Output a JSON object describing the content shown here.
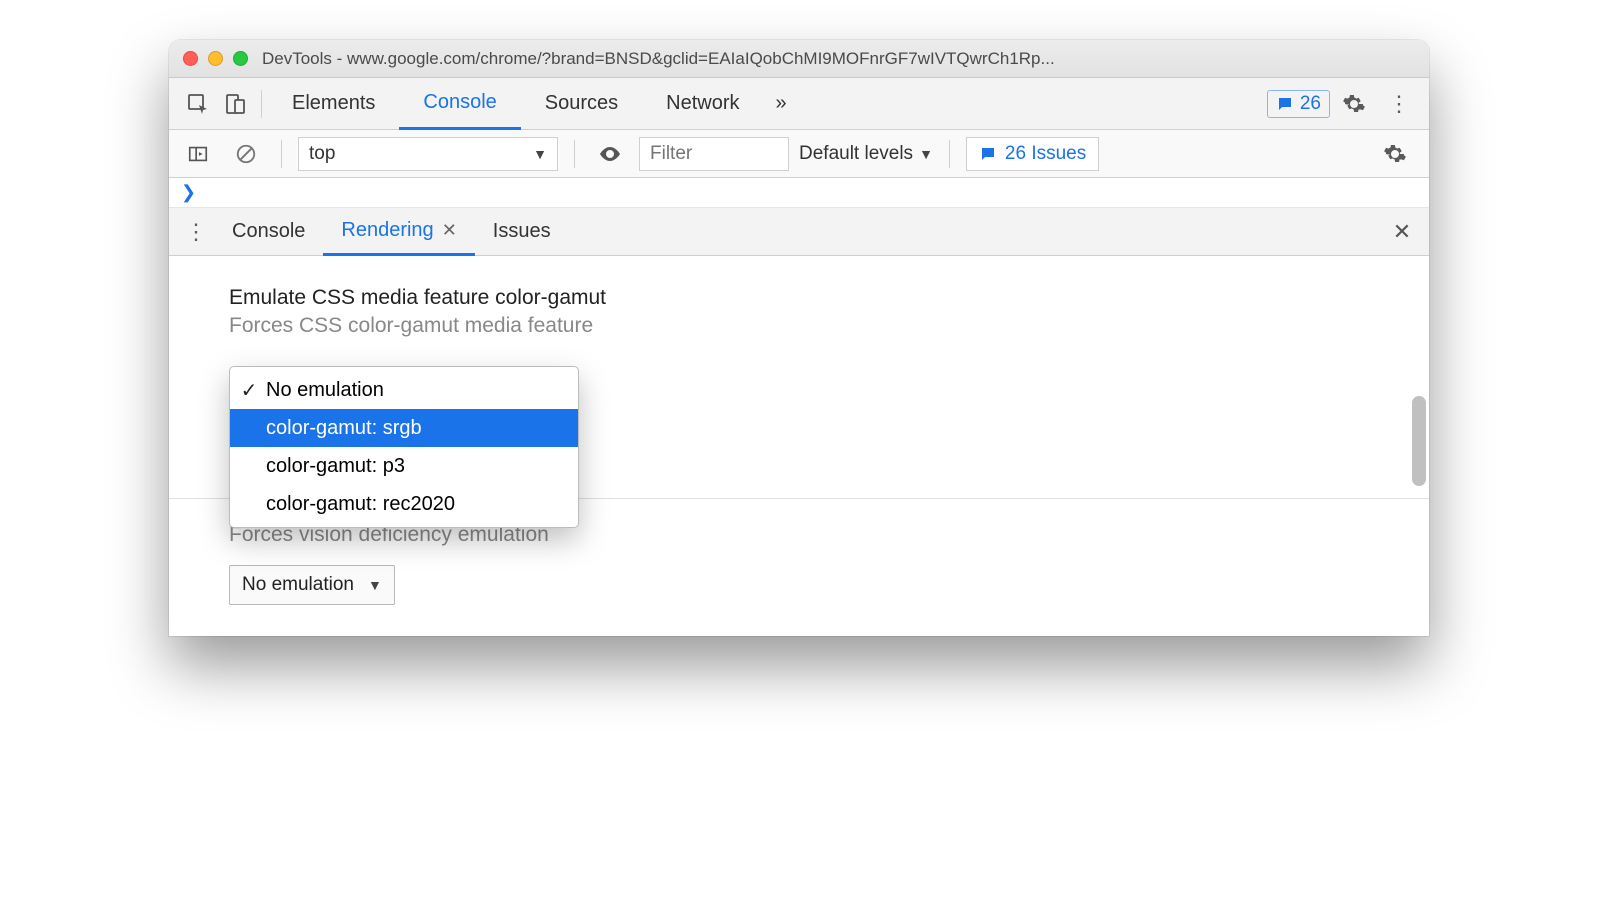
{
  "window": {
    "title": "DevTools - www.google.com/chrome/?brand=BNSD&gclid=EAIaIQobChMI9MOFnrGF7wIVTQwrCh1Rp..."
  },
  "tabs": {
    "items": [
      "Elements",
      "Console",
      "Sources",
      "Network"
    ],
    "active_index": 1,
    "more_indicator": "»",
    "issue_badge_count": "26"
  },
  "console_toolbar": {
    "context_label": "top",
    "filter_placeholder": "Filter",
    "levels_label": "Default levels",
    "issues_label": "26 Issues"
  },
  "drawer": {
    "tabs": [
      "Console",
      "Rendering",
      "Issues"
    ],
    "active_index": 1
  },
  "rendering": {
    "section_title": "Emulate CSS media feature color-gamut",
    "section_subtitle": "Forces CSS color-gamut media feature",
    "dropdown_options": [
      "No emulation",
      "color-gamut: srgb",
      "color-gamut: p3",
      "color-gamut: rec2020"
    ],
    "dropdown_checked_index": 0,
    "dropdown_highlight_index": 1,
    "obscured_subtitle": "Forces vision deficiency emulation",
    "next_select_value": "No emulation"
  }
}
